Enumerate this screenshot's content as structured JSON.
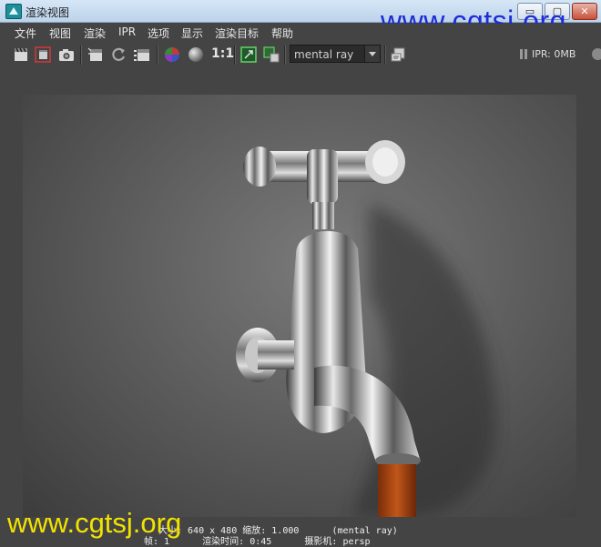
{
  "window": {
    "title": "渲染视图",
    "controls": {
      "minimize": "▭",
      "maximize": "▢",
      "close": "✕"
    }
  },
  "watermark": {
    "top": "www.cgtsj.org",
    "bottom": "www.cgtsj.org"
  },
  "menu": {
    "items": [
      "文件",
      "视图",
      "渲染",
      "IPR",
      "选项",
      "显示",
      "渲染目标",
      "帮助"
    ]
  },
  "toolbar": {
    "icons": [
      "render-frame-icon",
      "render-region-icon",
      "snapshot-icon",
      "ipr-render-icon",
      "refresh-icon",
      "render-sequence-icon",
      "color-channels-icon",
      "grey-sphere-icon",
      "one-to-one-icon",
      "frame-region-icon",
      "keep-image-icon",
      "render-settings-icon"
    ],
    "ratio_label": "1:1",
    "renderer": "mental ray",
    "ipr_status": "IPR: 0MB"
  },
  "render_info": {
    "line1": "大小: 640 x 480 缩放: 1.000      (mental ray)",
    "line2": "帧: 1      渲染时间: 0:45      摄影机: persp"
  },
  "colors": {
    "titlebar": "#c8dcf0",
    "panel": "#444444",
    "watermark_top": "#1d2bd8",
    "watermark_bottom": "#f2e200"
  }
}
